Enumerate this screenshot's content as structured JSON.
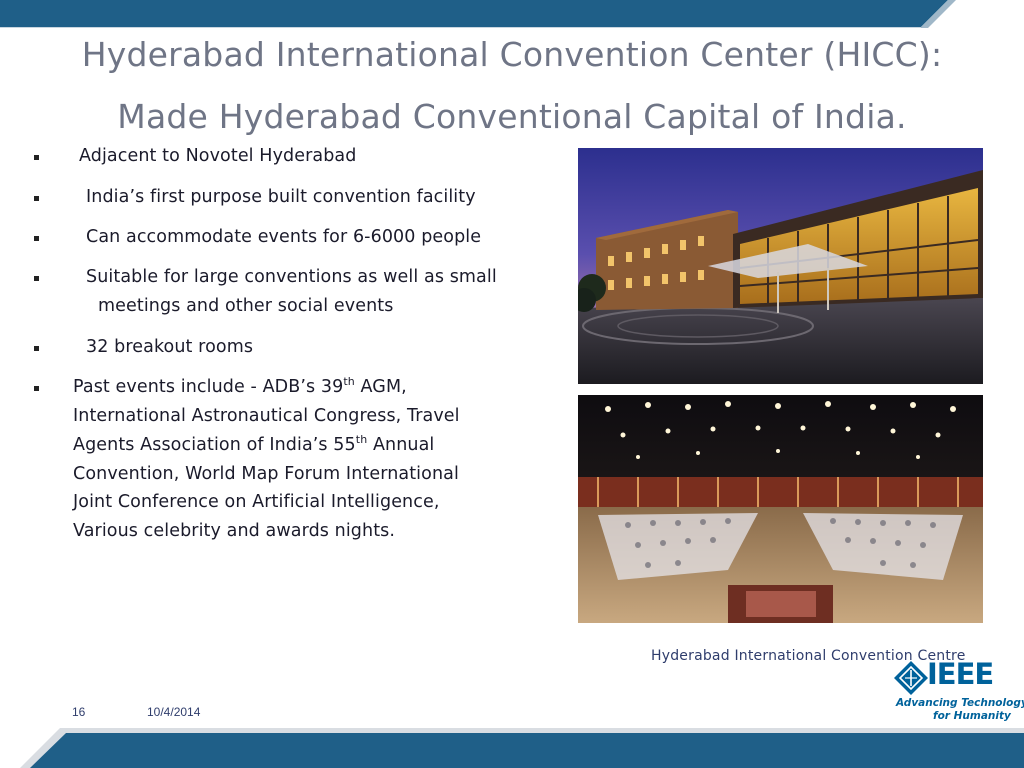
{
  "title": {
    "line1": "Hyderabad International Convention Center (HICC):",
    "line2": "Made Hyderabad Conventional Capital of India."
  },
  "bullets": {
    "b1": "Adjacent to Novotel Hyderabad",
    "b2": "India’s first purpose built convention facility",
    "b3": "Can accommodate events for 6-6000 people",
    "b4_line1": "Suitable for large conventions as well as small",
    "b4_line2": "meetings and other social events",
    "b5": "32 breakout rooms",
    "b6": {
      "l1_pre": "Past events include - ADB’s 39",
      "l1_sup": "th",
      "l1_post": " AGM,",
      "l2": "International Astronautical Congress, Travel",
      "l3_pre": "Agents Association of India’s 55",
      "l3_sup": "th",
      "l3_post": " Annual",
      "l4": "Convention, World Map Forum International",
      "l5": "Joint Conference on Artificial Intelligence,",
      "l6": "Various celebrity and awards nights."
    }
  },
  "caption": "Hyderabad International Convention Centre",
  "logo": {
    "word": "IEEE",
    "tagline1": "Advancing Technology",
    "tagline2": "for Humanity"
  },
  "footer": {
    "page_number": "16",
    "date": "10/4/2014"
  },
  "colors": {
    "band": "#1f5f88",
    "title": "#6f7586",
    "ieee_blue": "#00629b"
  }
}
